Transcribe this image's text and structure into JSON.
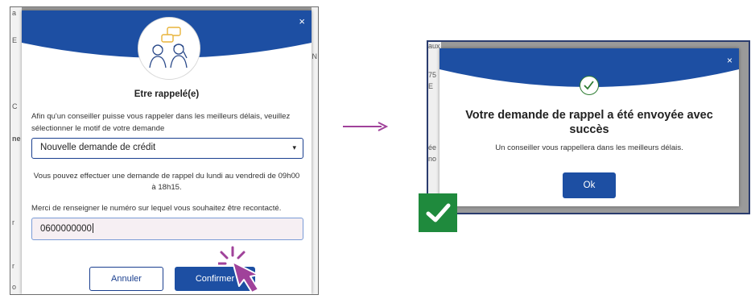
{
  "callback_modal": {
    "close_label": "×",
    "title": "Etre rappelé(e)",
    "intro": "Afin qu'un conseiller puisse vous rappeler dans les meilleurs délais, veuillez sélectionner le motif de votre demande",
    "reason_select": {
      "value": "Nouvelle demande de crédit",
      "caret": "▾"
    },
    "availability": "Vous pouvez effectuer une demande de rappel du lundi au vendredi de 09h00 à 18h15.",
    "phone_prompt": "Merci de renseigner le numéro sur lequel vous souhaitez être recontacté.",
    "phone_value": "0600000000",
    "cancel_label": "Annuler",
    "confirm_label": "Confirmer",
    "background_fragments": [
      "a",
      "E",
      "C",
      "ne",
      "r",
      "r",
      "o",
      "N",
      "N",
      "r"
    ]
  },
  "success_modal": {
    "close_label": "×",
    "title": "Votre demande de rappel a été envoyée avec succès",
    "subtitle": "Un conseiller vous rappellera dans les meilleurs délais.",
    "ok_label": "Ok",
    "background_fragments": [
      "aux",
      "75",
      "E",
      "ée",
      "no"
    ]
  },
  "colors": {
    "brand_blue": "#1d4fa3",
    "success_green": "#1f8a3d",
    "arrow_purple": "#a0429a"
  }
}
